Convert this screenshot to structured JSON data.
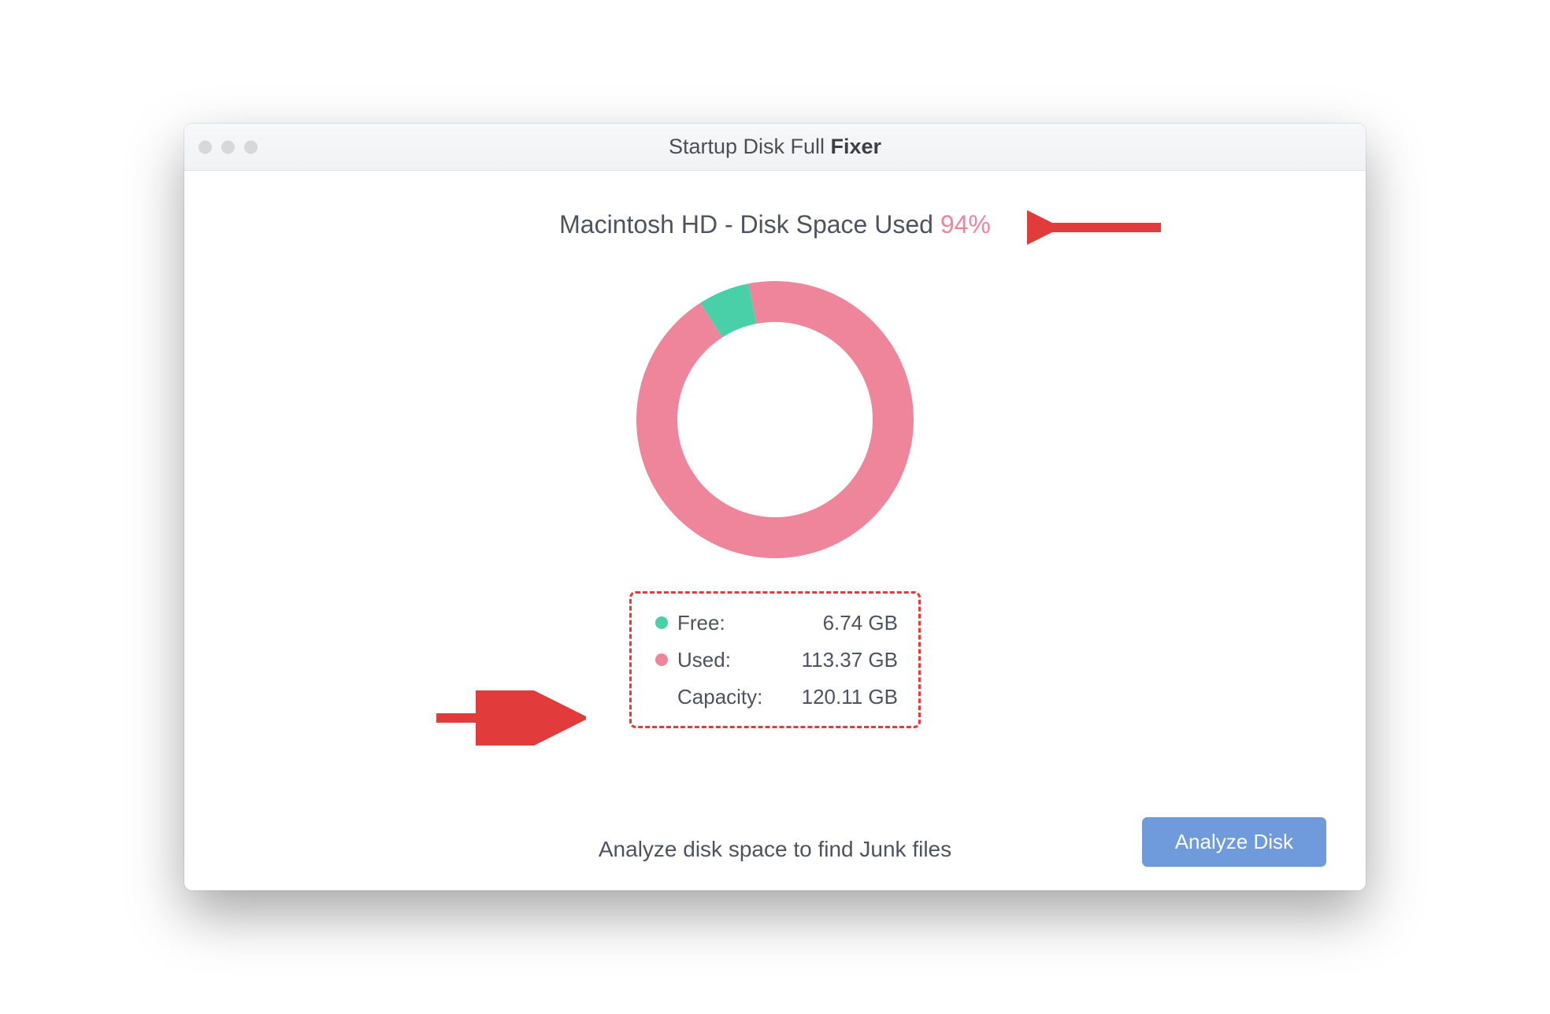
{
  "titlebar": {
    "title_prefix": "Startup Disk Full ",
    "title_bold": "Fixer"
  },
  "heading": {
    "disk_name": "Macintosh HD",
    "label": "Disk Space Used",
    "percent": "94%"
  },
  "legend": {
    "free": {
      "label": "Free:",
      "value": "6.74 GB",
      "color": "#49d0a9"
    },
    "used": {
      "label": "Used:",
      "value": "113.37 GB",
      "color": "#ef859a"
    },
    "capacity": {
      "label": "Capacity:",
      "value": "120.11 GB"
    }
  },
  "hint": "Analyze disk space to find Junk files",
  "button": {
    "analyze": "Analyze Disk"
  },
  "chart_data": {
    "type": "pie",
    "title": "Macintosh HD - Disk Space Used 94%",
    "series": [
      {
        "name": "Used",
        "value": 113.37,
        "unit": "GB",
        "color": "#ef859a"
      },
      {
        "name": "Free",
        "value": 6.74,
        "unit": "GB",
        "color": "#49d0a9"
      }
    ],
    "total": {
      "name": "Capacity",
      "value": 120.11,
      "unit": "GB"
    },
    "donut": true
  },
  "colors": {
    "accent_pink": "#ef859a",
    "accent_green": "#49d0a9",
    "button_blue": "#6f9bdc",
    "annotation_red": "#e23b3b"
  }
}
